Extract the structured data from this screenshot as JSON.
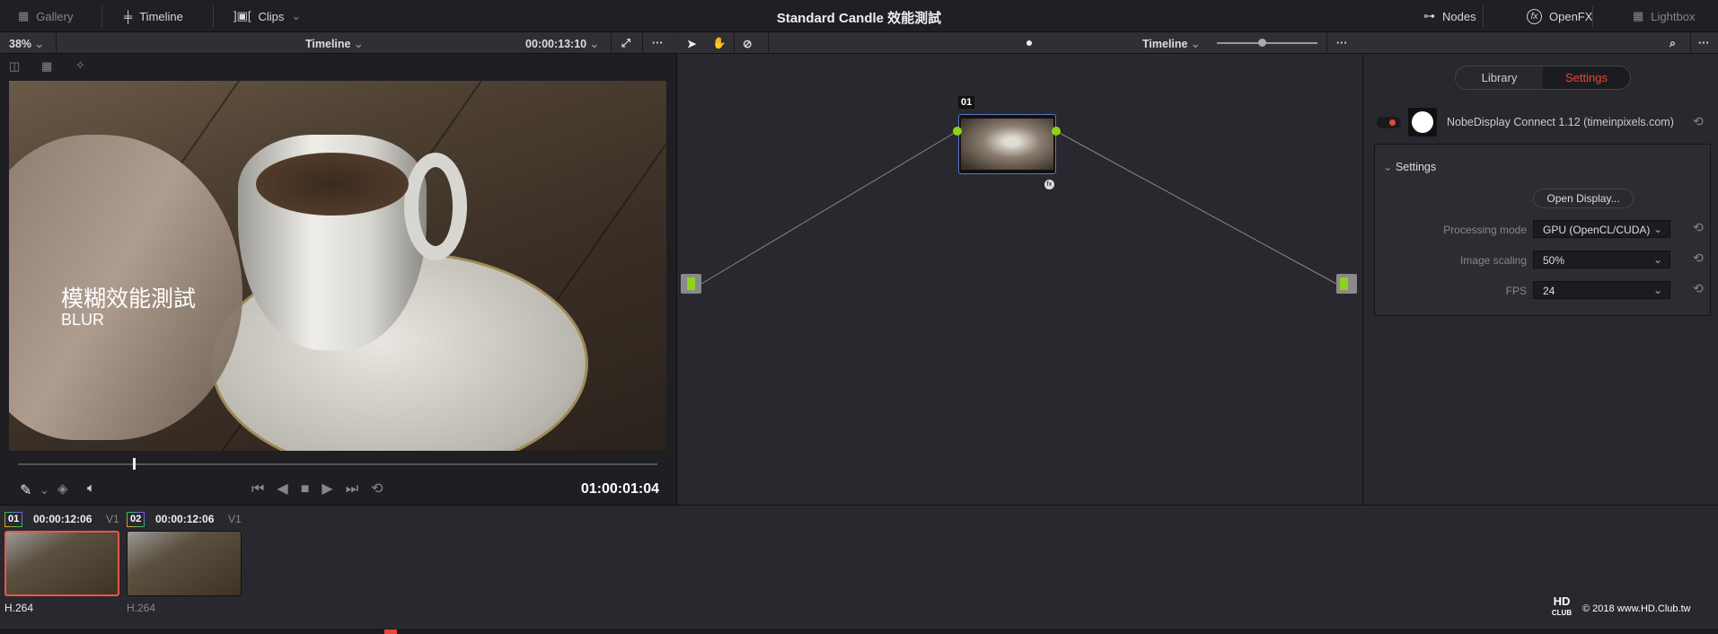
{
  "topbar": {
    "gallery": "Gallery",
    "timeline": "Timeline",
    "clips": "Clips",
    "title": "Standard Candle 效能測試",
    "nodes": "Nodes",
    "openfx": "OpenFX",
    "lightbox": "Lightbox"
  },
  "viewer": {
    "zoom": "38%",
    "timeline": "Timeline",
    "timecode_total": "00:00:13:10",
    "overlay_cn": "模糊效能測試",
    "overlay_en": "BLUR",
    "timecode": "01:00:01:04",
    "playhead_fraction": 0.18
  },
  "nodes": {
    "timeline": "Timeline",
    "node_label": "01"
  },
  "inspector": {
    "tabs": [
      "Library",
      "Settings"
    ],
    "active_tab": "Settings",
    "plugin": "NobeDisplay Connect 1.12 (timeinpixels.com)",
    "section": "Settings",
    "open_display": "Open Display...",
    "params": [
      {
        "label": "Processing mode",
        "value": "GPU (OpenCL/CUDA)"
      },
      {
        "label": "Image scaling",
        "value": "50%"
      },
      {
        "label": "FPS",
        "value": "24"
      }
    ]
  },
  "clips": [
    {
      "num": "01",
      "tc": "00:00:12:06",
      "track": "V1",
      "codec": "H.264"
    },
    {
      "num": "02",
      "tc": "00:00:12:06",
      "track": "V1",
      "codec": "H.264"
    }
  ],
  "watermark": {
    "logo": "HD CLUB",
    "text": "© 2018 www.HD.Club.tw"
  },
  "colors": {
    "accent": "#e8463a",
    "node_dot": "#8fd11c"
  }
}
